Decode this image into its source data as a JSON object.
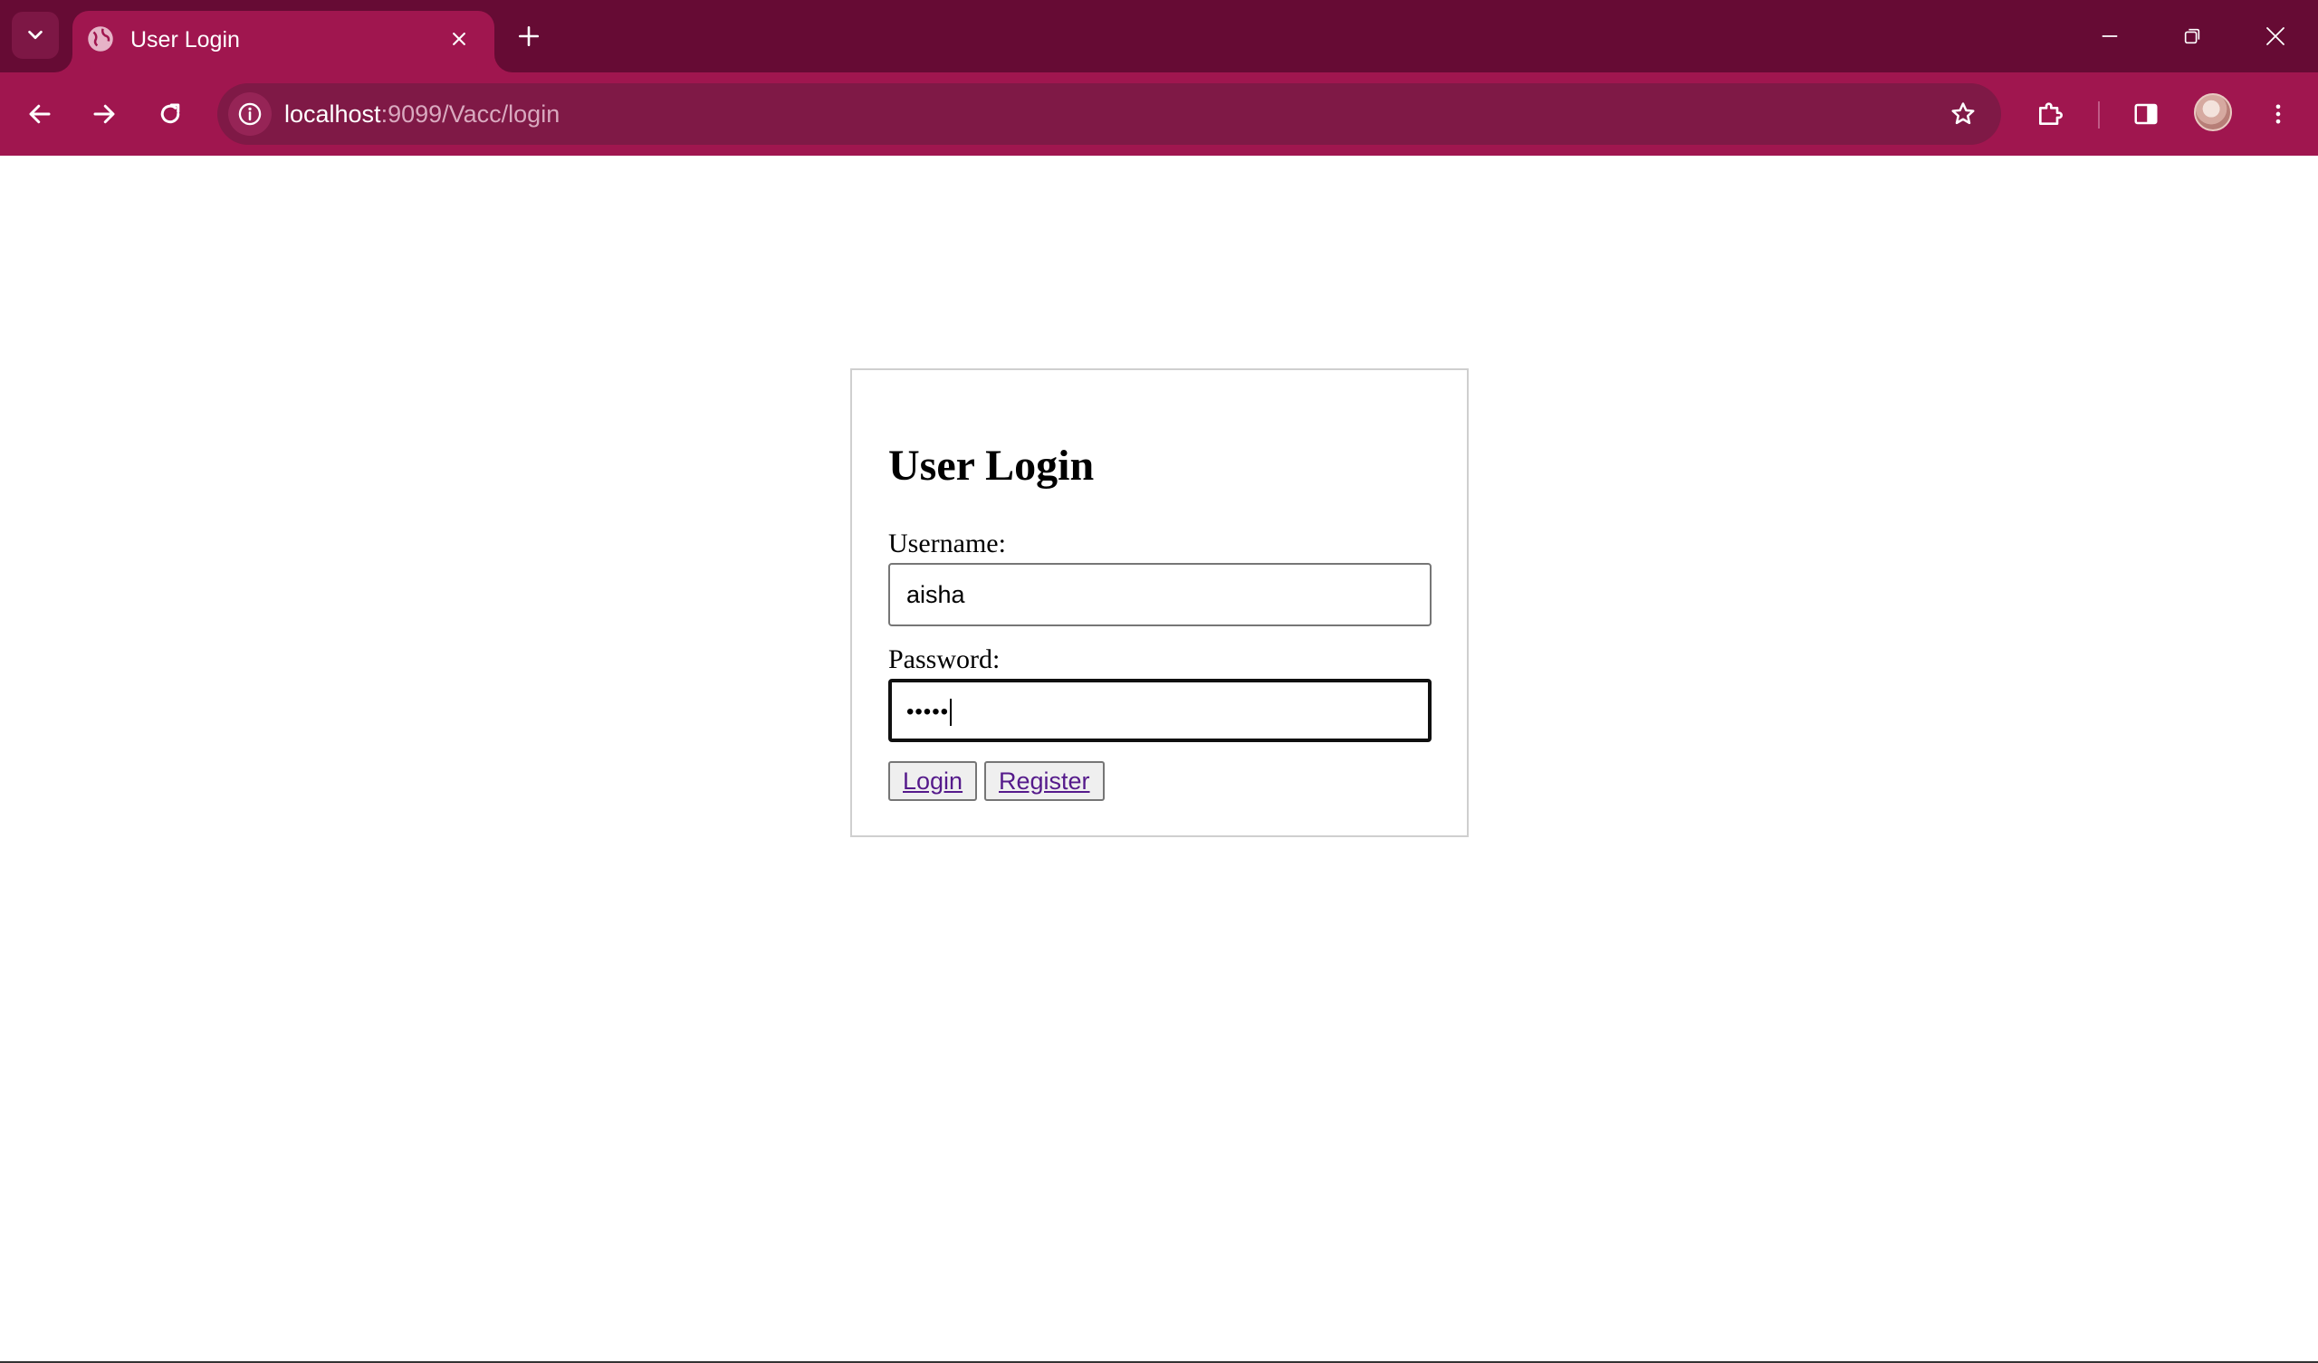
{
  "browser": {
    "tab_title": "User Login",
    "url_host": "localhost",
    "url_rest": ":9099/Vacc/login",
    "colors": {
      "tabstrip": "#660b34",
      "toolbar": "#a0164f",
      "omnibox": "#7f1946"
    },
    "icons": {
      "tab_search": "chevron-down-icon",
      "favicon": "globe-icon",
      "tab_close": "close-icon",
      "new_tab": "plus-icon",
      "minimize": "minimize-icon",
      "restore": "restore-icon",
      "close_window": "close-icon",
      "back": "arrow-left-icon",
      "forward": "arrow-right-icon",
      "reload": "reload-icon",
      "site_info": "info-icon",
      "bookmark": "star-icon",
      "extensions": "puzzle-icon",
      "side_panel": "side-panel-icon",
      "profile": "avatar",
      "menu": "kebab-menu-icon"
    }
  },
  "login": {
    "title": "User Login",
    "username_label": "Username:",
    "username_value": "aisha",
    "password_label": "Password:",
    "password_masked": "•••••",
    "login_button": "Login",
    "register_button": "Register"
  }
}
